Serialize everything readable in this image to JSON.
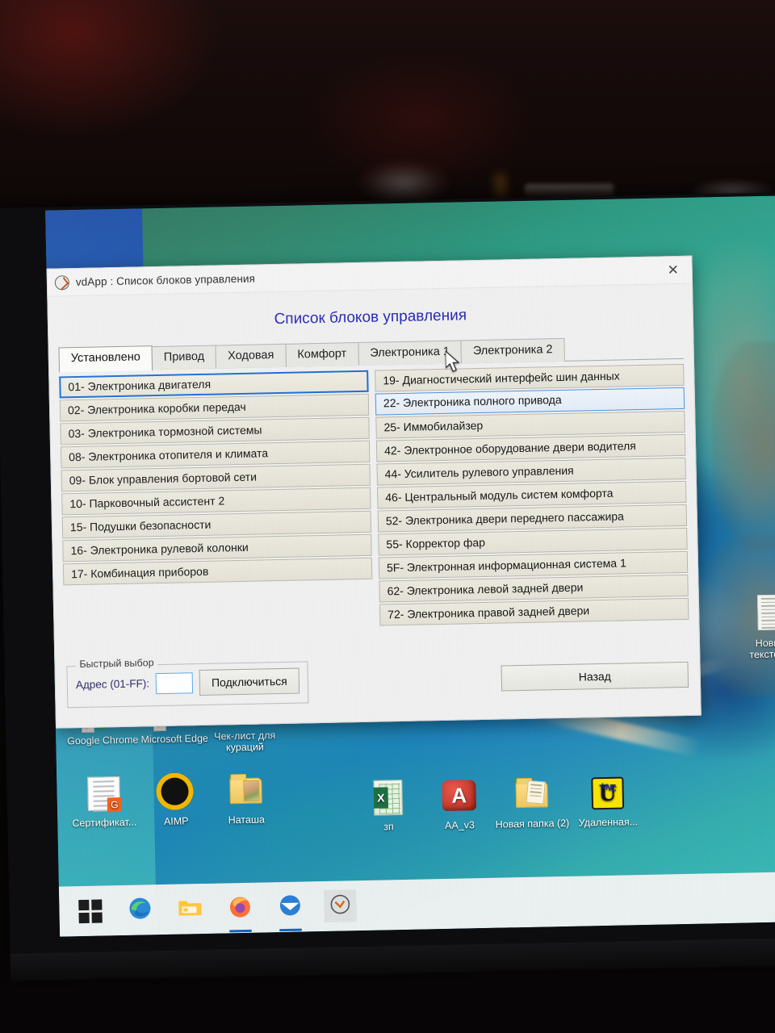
{
  "window": {
    "title": "vdApp :  Список блоков управления",
    "app_icon": "gauge-icon",
    "close_label": "✕"
  },
  "dialog": {
    "heading": "Список блоков управления",
    "tabs": [
      {
        "label": "Установлено",
        "active": true
      },
      {
        "label": "Привод",
        "active": false
      },
      {
        "label": "Ходовая",
        "active": false
      },
      {
        "label": "Комфорт",
        "active": false
      },
      {
        "label": "Электроника 1",
        "active": false
      },
      {
        "label": "Электроника 2",
        "active": false
      }
    ],
    "left_list": [
      {
        "label": "01- Электроника двигателя",
        "state": "focused"
      },
      {
        "label": "02- Электроника коробки передач",
        "state": "normal"
      },
      {
        "label": "03- Электроника тормозной системы",
        "state": "normal"
      },
      {
        "label": "08- Электроника отопителя и климата",
        "state": "normal"
      },
      {
        "label": "09- Блок управления бортовой сети",
        "state": "normal"
      },
      {
        "label": "10- Парковочный ассистент 2",
        "state": "normal"
      },
      {
        "label": "15- Подушки безопасности",
        "state": "normal"
      },
      {
        "label": "16- Электроника рулевой колонки",
        "state": "normal"
      },
      {
        "label": "17- Комбинация приборов",
        "state": "normal"
      }
    ],
    "right_list": [
      {
        "label": "19- Диагностический интерфейс шин данных",
        "state": "normal"
      },
      {
        "label": "22- Электроника полного привода",
        "state": "hover"
      },
      {
        "label": "25- Иммобилайзер",
        "state": "normal"
      },
      {
        "label": "42- Электронное оборудование двери водителя",
        "state": "normal"
      },
      {
        "label": "44- Усилитель рулевого управления",
        "state": "normal"
      },
      {
        "label": "46- Центральный модуль систем комфорта",
        "state": "normal"
      },
      {
        "label": "52- Электроника двери переднего пассажира",
        "state": "normal"
      },
      {
        "label": "55- Корректор фар",
        "state": "normal"
      },
      {
        "label": "5F- Электронная информационная система 1",
        "state": "normal"
      },
      {
        "label": "62- Электроника левой задней двери",
        "state": "normal"
      },
      {
        "label": "72- Электроника правой задней двери",
        "state": "normal"
      }
    ],
    "quick_select": {
      "legend": "Быстрый выбор",
      "address_label": "Адрес (01-FF):",
      "address_value": "",
      "address_placeholder": "",
      "connect_label": "Подключиться"
    },
    "back_label": "Назад"
  },
  "desktop": {
    "icons": [
      {
        "name": "google-chrome",
        "label": "Google Chrome",
        "icon": "chrome-icon"
      },
      {
        "name": "microsoft-edge",
        "label": "Microsoft Edge",
        "icon": "edge-icon"
      },
      {
        "name": "check-list-doc",
        "label": "Чек-лист для кураций",
        "icon": "word-document-icon"
      },
      {
        "name": "certificate-file",
        "label": "Сертификат...",
        "icon": "certificate-icon"
      },
      {
        "name": "aimp-player",
        "label": "AIMP",
        "icon": "aimp-icon"
      },
      {
        "name": "natasha-folder",
        "label": "Наташа",
        "icon": "folder-photo-icon"
      },
      {
        "name": "zp-spreadsheet",
        "label": "зп",
        "icon": "excel-icon"
      },
      {
        "name": "aa-v3",
        "label": "AA_v3",
        "icon": "autodata-icon"
      },
      {
        "name": "new-folder-2",
        "label": "Новая папка (2)",
        "icon": "folder-icon"
      },
      {
        "name": "remote-vnc",
        "label": "Удаленная...",
        "icon": "ultravnc-icon"
      },
      {
        "name": "new-text-file",
        "label": "Новый текстов...",
        "icon": "text-file-icon"
      }
    ]
  },
  "taskbar": {
    "items": [
      {
        "name": "start-button",
        "icon": "windows-logo-icon",
        "active": false
      },
      {
        "name": "edge-taskbar",
        "icon": "edge-icon",
        "active": false
      },
      {
        "name": "file-explorer-taskbar",
        "icon": "folder-icon",
        "active": false
      },
      {
        "name": "firefox-taskbar",
        "icon": "firefox-icon",
        "active": false
      },
      {
        "name": "thunderbird-taskbar",
        "icon": "thunderbird-icon",
        "active": false
      },
      {
        "name": "vdapp-taskbar",
        "icon": "gauge-icon",
        "active": true
      }
    ]
  },
  "colors": {
    "heading": "#2a2ab8",
    "focus_border": "#1b6fd6",
    "hover_border": "#4b93e0",
    "list_bg": "#eceadf",
    "dialog_bg": "#f0f0f0"
  }
}
